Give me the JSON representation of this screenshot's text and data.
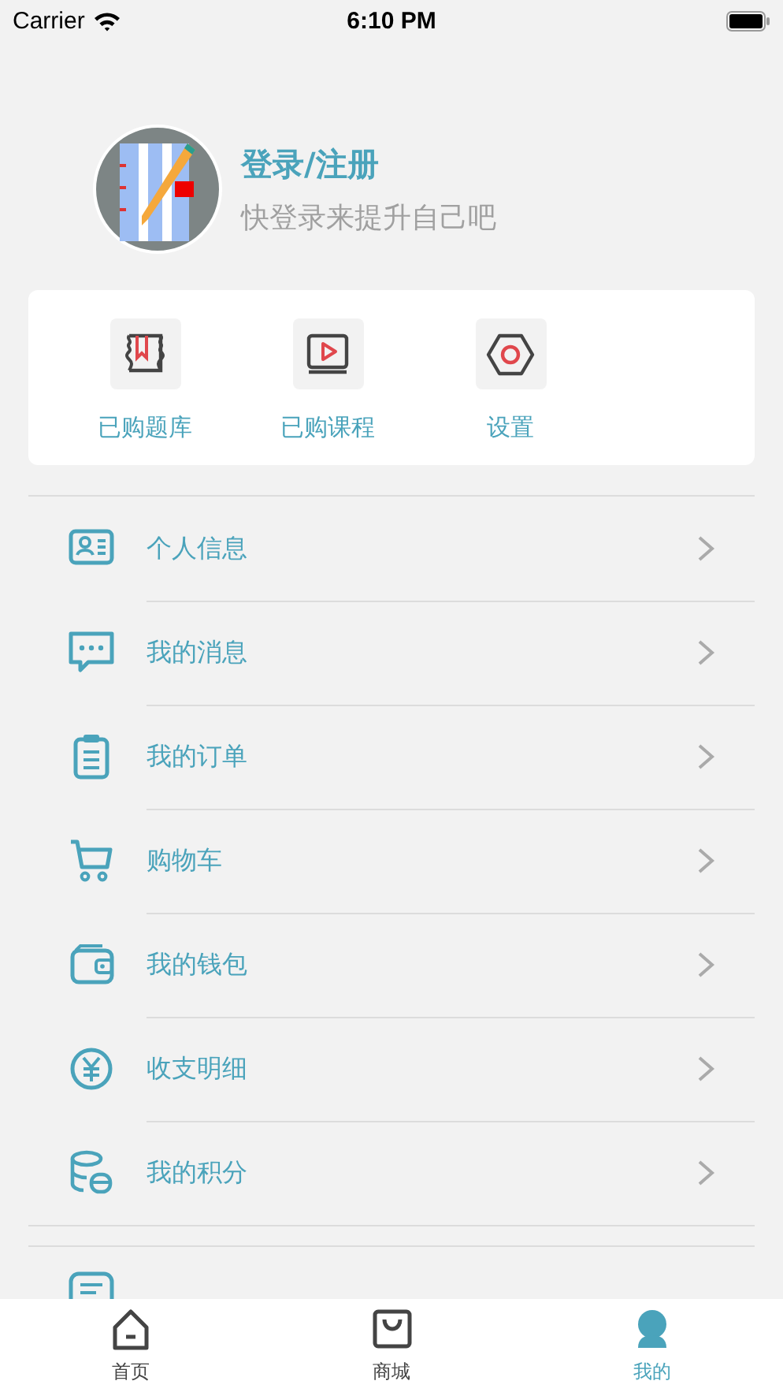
{
  "status_bar": {
    "carrier": "Carrier",
    "time": "6:10 PM"
  },
  "profile": {
    "title": "登录/注册",
    "subtitle": "快登录来提升自己吧"
  },
  "shortcuts": [
    {
      "label": "已购题库"
    },
    {
      "label": "已购课程"
    },
    {
      "label": "设置"
    }
  ],
  "menu": [
    {
      "label": "个人信息"
    },
    {
      "label": "我的消息"
    },
    {
      "label": "我的订单"
    },
    {
      "label": "购物车"
    },
    {
      "label": "我的钱包"
    },
    {
      "label": "收支明细"
    },
    {
      "label": "我的积分"
    }
  ],
  "tabs": [
    {
      "label": "首页",
      "selected": false
    },
    {
      "label": "商城",
      "selected": false
    },
    {
      "label": "我的",
      "selected": true
    }
  ]
}
